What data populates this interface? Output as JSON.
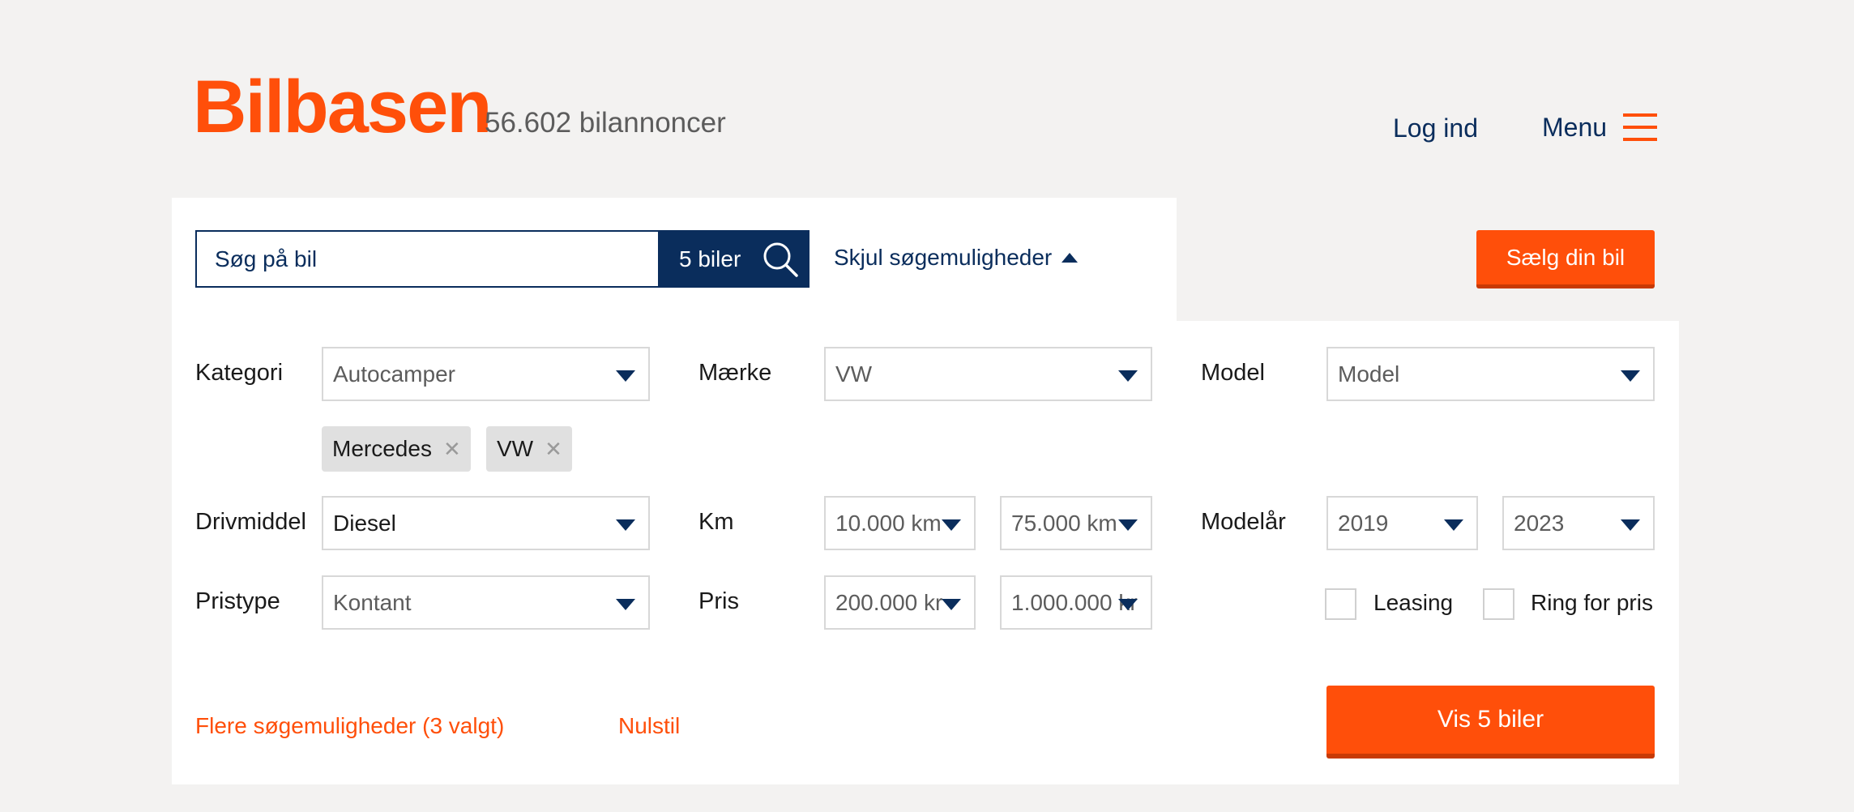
{
  "header": {
    "logo": "Bilbasen",
    "ad_count": "56.602 bilannoncer",
    "login": "Log ind",
    "menu": "Menu"
  },
  "search": {
    "placeholder": "Søg på bil",
    "button_label": "5 biler",
    "toggle_label": "Skjul søgemuligheder",
    "sell_label": "Sælg din bil"
  },
  "filters": {
    "kategori": {
      "label": "Kategori",
      "value": "Autocamper"
    },
    "maerke": {
      "label": "Mærke",
      "value": "VW"
    },
    "model": {
      "label": "Model",
      "value": "Model"
    },
    "chips": [
      "Mercedes",
      "VW"
    ],
    "drivmiddel": {
      "label": "Drivmiddel",
      "value": "Diesel"
    },
    "km": {
      "label": "Km",
      "from": "10.000 km",
      "to": "75.000 km"
    },
    "modelaar": {
      "label": "Modelår",
      "from": "2019",
      "to": "2023"
    },
    "pristype": {
      "label": "Pristype",
      "value": "Kontant"
    },
    "pris": {
      "label": "Pris",
      "from": "200.000 kr",
      "to": "1.000.000 kr"
    },
    "leasing": {
      "label": "Leasing",
      "checked": false
    },
    "ring_for_pris": {
      "label": "Ring for pris",
      "checked": false
    }
  },
  "footer": {
    "more_options": "Flere søgemuligheder (3 valgt)",
    "reset": "Nulstil",
    "show_button": "Vis 5 biler"
  },
  "colors": {
    "brand_orange": "#ff4f0a",
    "navy": "#0a2d5c",
    "background": "#f3f2f1"
  },
  "icons": {
    "hamburger": "hamburger-menu-icon",
    "search": "search-icon",
    "caret_up": "caret-up-icon",
    "dropdown": "chevron-down-icon",
    "remove": "close-icon"
  }
}
